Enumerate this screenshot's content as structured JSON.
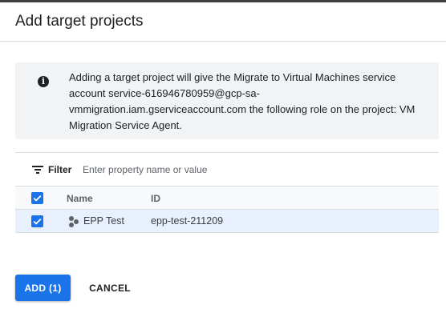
{
  "dialog": {
    "title": "Add target projects"
  },
  "info": {
    "icon": "info-icon",
    "message": "Adding a target project will give the Migrate to Virtual Machines service account service-616946780959@gcp-sa-vmmigration.iam.gserviceaccount.com the following role on the project: VM Migration Service Agent."
  },
  "filter": {
    "label": "Filter",
    "placeholder": "Enter property name or value",
    "icon": "filter-list-icon"
  },
  "table": {
    "columns": [
      "Name",
      "ID"
    ],
    "rows": [
      {
        "selected": true,
        "icon": "project-icon",
        "name": "EPP Test",
        "id": "epp-test-211209"
      }
    ],
    "select_all_checked": true
  },
  "actions": {
    "add_label": "ADD (1)",
    "cancel_label": "CANCEL"
  },
  "colors": {
    "accent": "#1a73e8",
    "info_bg": "#f1f3f4",
    "selected_row_bg": "#e8f0fe"
  }
}
